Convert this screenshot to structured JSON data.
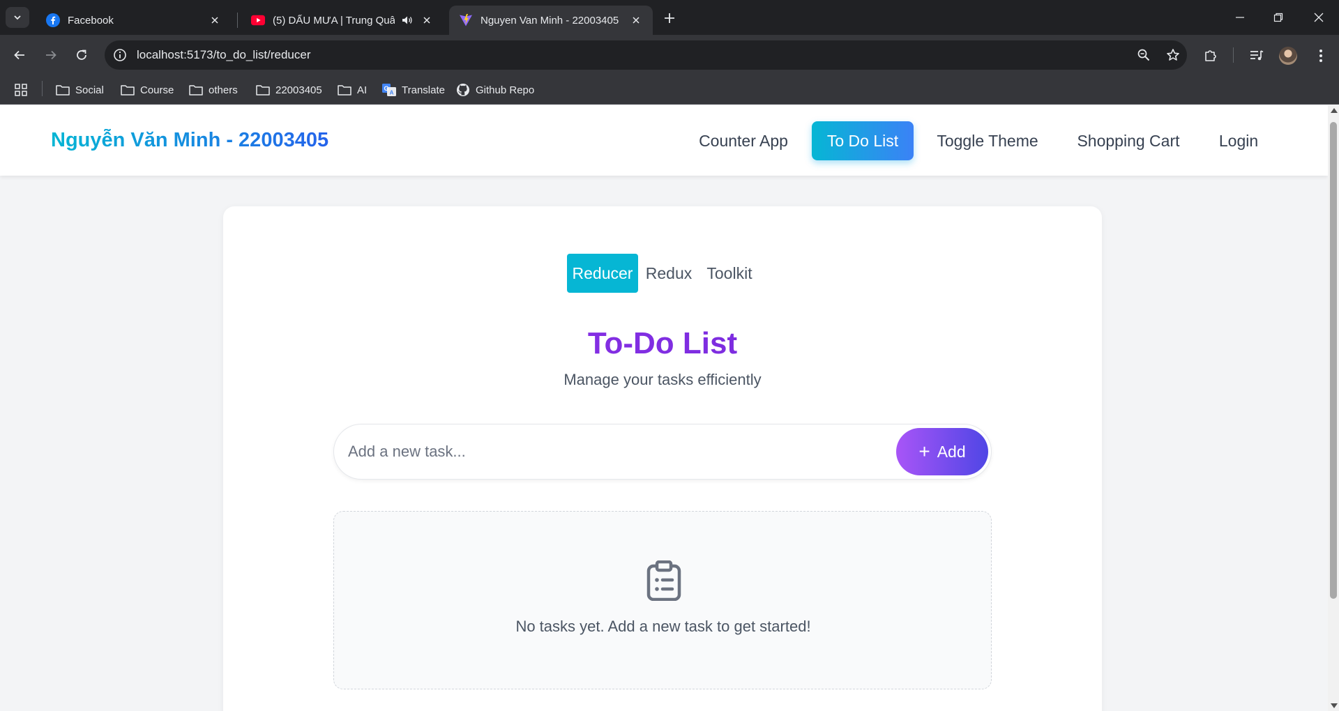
{
  "browser": {
    "tabs": [
      {
        "title": "Facebook",
        "icon": "facebook-icon"
      },
      {
        "title": "(5) DẤU MƯA | Trung Quân",
        "icon": "youtube-icon"
      },
      {
        "title": "Nguyen Van Minh - 22003405",
        "icon": "vite-icon"
      }
    ],
    "url": "localhost:5173/to_do_list/reducer",
    "bookmarks": [
      "Social",
      "Course",
      "others",
      "22003405",
      "AI",
      "Translate",
      "Github Repo"
    ]
  },
  "app": {
    "brand": "Nguyễn Văn Minh - 22003405",
    "nav": [
      "Counter App",
      "To Do List",
      "Toggle Theme",
      "Shopping Cart",
      "Login"
    ],
    "active_nav": "To Do List",
    "accent_color": "#06b6d4"
  },
  "todo": {
    "tabs": [
      "Reducer",
      "Redux",
      "Toolkit"
    ],
    "active_tab": "Reducer",
    "title": "To-Do List",
    "subtitle": "Manage your tasks efficiently",
    "input_placeholder": "Add a new task...",
    "input_value": "",
    "add_label": "Add",
    "empty_text": "No tasks yet. Add a new task to get started!",
    "empty_icon": "clipboard-list-icon",
    "title_color": "#7c3aed"
  }
}
